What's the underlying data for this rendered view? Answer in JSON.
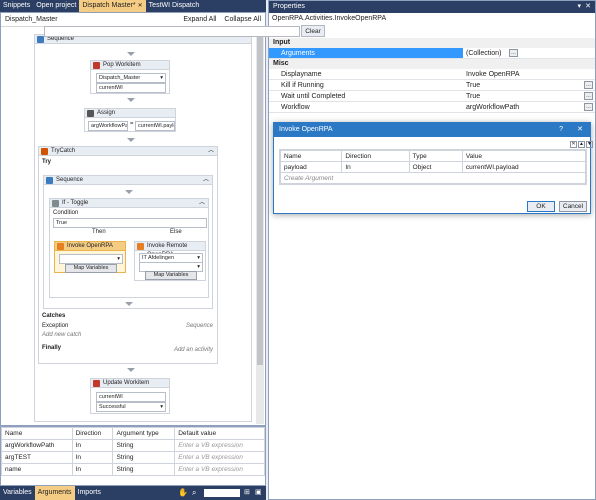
{
  "tabs": [
    {
      "label": "Snippets"
    },
    {
      "label": "Open project"
    },
    {
      "label": "Dispatch Master*"
    },
    {
      "label": "TestWI Dispatch"
    }
  ],
  "designer": {
    "title": "Dispatch_Master",
    "expand_all": "Expand All",
    "collapse_all": "Collapse All"
  },
  "workflow": {
    "sequence": "Sequence",
    "pop": {
      "title": "Pop Workitem",
      "queue": "Dispatch_Master",
      "var": "currentWI"
    },
    "assign": {
      "title": "Assign",
      "left": "argWorkflowPath",
      "right": "currentWI.payload"
    },
    "trycatch": {
      "title": "TryCatch",
      "try": "Try",
      "catches": "Catches",
      "exception": "Exception",
      "sequence_label": "Sequence",
      "add_catch": "Add new catch",
      "finally": "Finally",
      "add_activity": "Add an activity"
    },
    "inner_sequence": "Sequence",
    "ifbox": {
      "title": "If - Toggle",
      "condition_label": "Condition",
      "condition": "True",
      "then": "Then",
      "else": "Else"
    },
    "invoke": {
      "title": "Invoke OpenRPA",
      "map": "Map Variables"
    },
    "invoke_remote": {
      "title": "Invoke Remote OpenRPA",
      "target": "IT Afdelingen",
      "map": "Map Variables"
    },
    "update": {
      "title": "Update Workitem",
      "var": "currentWI",
      "status": "Successful"
    }
  },
  "variables": {
    "headers": [
      "Name",
      "Direction",
      "Argument type",
      "Default value"
    ],
    "rows": [
      {
        "name": "argWorkflowPath",
        "dir": "In",
        "type": "String",
        "def": "Enter a VB expression"
      },
      {
        "name": "argTEST",
        "dir": "In",
        "type": "String",
        "def": "Enter a VB expression"
      },
      {
        "name": "name",
        "dir": "In",
        "type": "String",
        "def": "Enter a VB expression"
      }
    ]
  },
  "bottom_tabs": [
    {
      "label": "Variables"
    },
    {
      "label": "Arguments"
    },
    {
      "label": "Imports"
    }
  ],
  "properties": {
    "title": "Properties",
    "class": "OpenRPA.Activities.InvokeOpenRPA",
    "clear": "Clear",
    "input_cat": "Input",
    "arguments_k": "Arguments",
    "arguments_v": "(Collection)",
    "misc_cat": "Misc",
    "rows": [
      {
        "k": "Displayname",
        "v": "Invoke OpenRPA"
      },
      {
        "k": "Kill if Running",
        "v": "True"
      },
      {
        "k": "Wait until Completed",
        "v": "True"
      },
      {
        "k": "Workflow",
        "v": "argWorkflowPath"
      }
    ]
  },
  "dialog": {
    "title": "Invoke OpenRPA",
    "q": "?",
    "x": "✕",
    "headers": [
      "Name",
      "Direction",
      "Type",
      "Value"
    ],
    "row": {
      "name": "payload",
      "dir": "In",
      "type": "Object",
      "value": "currentWI.payload"
    },
    "create": "Create Argument",
    "ok": "OK",
    "cancel": "Cancel"
  }
}
